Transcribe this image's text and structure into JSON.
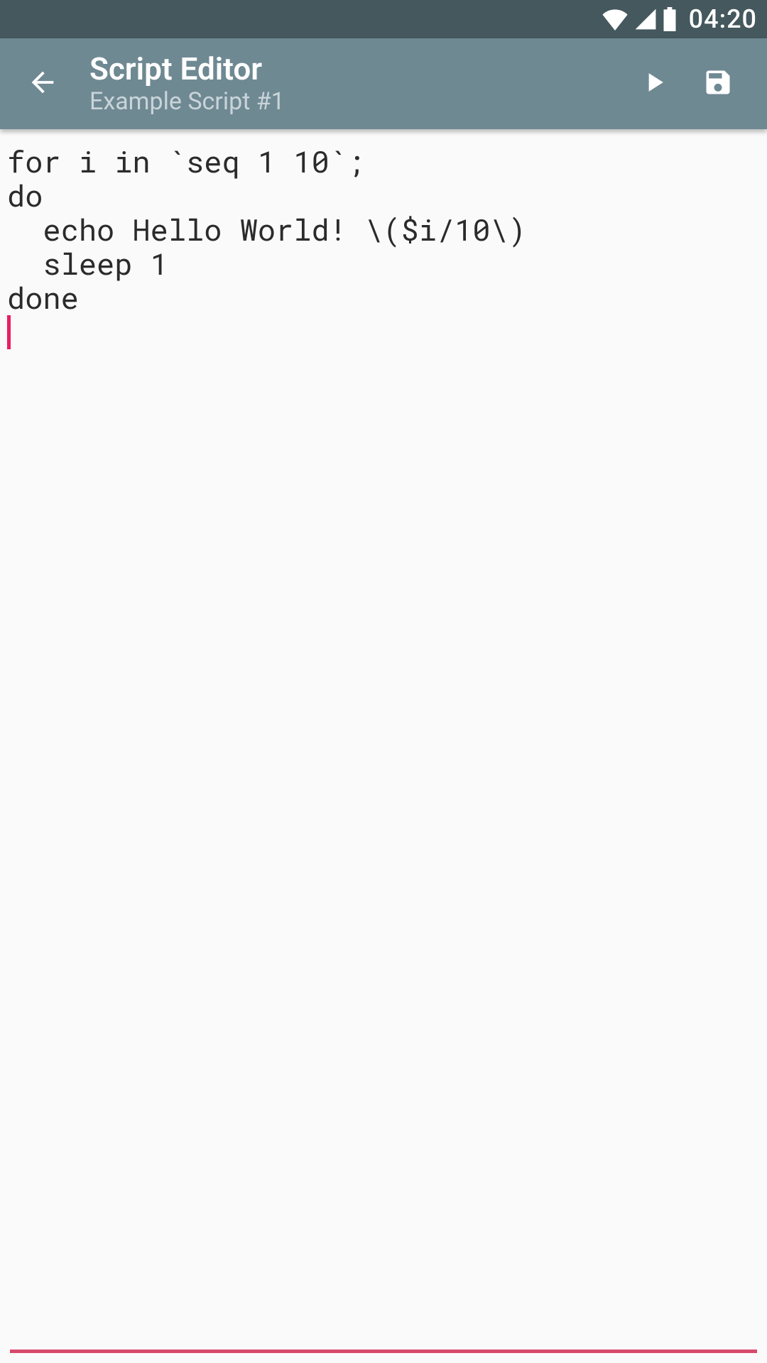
{
  "status": {
    "time": "04:20"
  },
  "appbar": {
    "title": "Script Editor",
    "subtitle": "Example Script #1"
  },
  "editor": {
    "content": "for i in `seq 1 10`;\ndo\n  echo Hello World! \\($i/10\\)\n  sleep 1\ndone\n"
  },
  "colors": {
    "statusbar": "#44585e",
    "appbar": "#6f8993",
    "accent": "#e91e63"
  }
}
